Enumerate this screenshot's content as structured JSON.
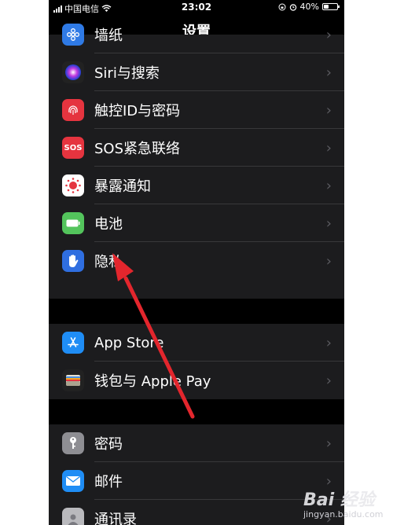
{
  "status_bar": {
    "carrier": "中国电信",
    "time": "23:02",
    "battery": "40%",
    "battery_level": 0.4
  },
  "header": {
    "title": "设置"
  },
  "groups": [
    {
      "items": [
        {
          "label": "墙纸",
          "icon": "wallpaper-icon",
          "icon_color": "#2f7ae5"
        },
        {
          "label": "Siri与搜索",
          "icon": "siri-icon",
          "icon_color": "#222222"
        },
        {
          "label": "触控ID与密码",
          "icon": "fingerprint-icon",
          "icon_color": "#e5343f"
        },
        {
          "label": "SOS紧急联络",
          "icon": "sos-icon",
          "icon_color": "#e5343f",
          "icon_text": "SOS"
        },
        {
          "label": "暴露通知",
          "icon": "exposure-icon",
          "icon_color": "#ffffff"
        },
        {
          "label": "电池",
          "icon": "battery-icon",
          "icon_color": "#53c45c"
        },
        {
          "label": "隐私",
          "icon": "hand-icon",
          "icon_color": "#2f6ee0"
        }
      ]
    },
    {
      "items": [
        {
          "label": "App Store",
          "icon": "app-store-icon",
          "icon_color": "#1f8df5"
        },
        {
          "label": "钱包与 Apple Pay",
          "icon": "wallet-icon",
          "icon_color": "#222222"
        }
      ]
    },
    {
      "items": [
        {
          "label": "密码",
          "icon": "key-icon",
          "icon_color": "#8e8e93"
        },
        {
          "label": "邮件",
          "icon": "mail-icon",
          "icon_color": "#1f8df5"
        },
        {
          "label": "通讯录",
          "icon": "contacts-icon",
          "icon_color": "#b9b9bd"
        }
      ]
    }
  ],
  "chevron": "›",
  "annotation": {
    "arrow_color": "#e3262d"
  },
  "watermark": {
    "brand": "Bai 经验",
    "url": "jingyan.baidu.com"
  }
}
